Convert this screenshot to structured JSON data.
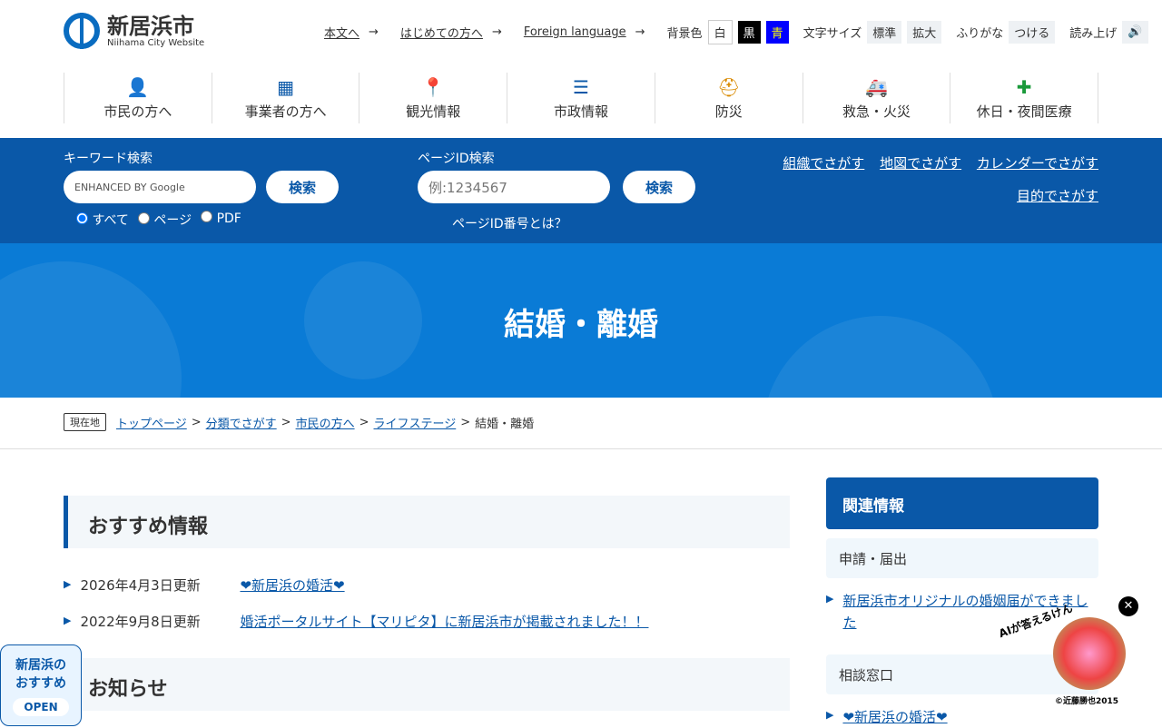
{
  "header": {
    "logo_title": "新居浜市",
    "logo_sub": "Niihama City Website",
    "util_links": [
      "本文へ",
      "はじめての方へ",
      "Foreign language"
    ],
    "bg_label": "背景色",
    "bg_options": [
      "白",
      "黒",
      "青"
    ],
    "font_label": "文字サイズ",
    "font_options": [
      "標準",
      "拡大"
    ],
    "furigana_label": "ふりがな",
    "furigana_btn": "つける",
    "read_label": "読み上げ"
  },
  "nav": [
    {
      "label": "市民の方へ",
      "icon": "person-icon",
      "glyph": "👤"
    },
    {
      "label": "事業者の方へ",
      "icon": "building-icon",
      "glyph": "▦"
    },
    {
      "label": "観光情報",
      "icon": "map-pin-icon",
      "glyph": "📍"
    },
    {
      "label": "市政情報",
      "icon": "list-icon",
      "glyph": "☰"
    },
    {
      "label": "防災",
      "icon": "helmet-icon",
      "glyph": "⛑"
    },
    {
      "label": "救急・火災",
      "icon": "ambulance-icon",
      "glyph": "🚑"
    },
    {
      "label": "休日・夜間医療",
      "icon": "first-aid-icon",
      "glyph": "✚"
    }
  ],
  "search": {
    "keyword_label": "キーワード検索",
    "google_placeholder": "ENHANCED BY Google",
    "search_btn": "検索",
    "radios": [
      "すべて",
      "ページ",
      "PDF"
    ],
    "pageid_label": "ページID検索",
    "pageid_placeholder": "例:1234567",
    "pageid_help": "ページID番号とは？",
    "links": [
      "組織でさがす",
      "地図でさがす",
      "カレンダーでさがす",
      "目的でさがす"
    ]
  },
  "hero_title": "結婚・離婚",
  "breadcrumb": {
    "here": "現在地",
    "items": [
      "トップページ",
      "分類でさがす",
      "市民の方へ",
      "ライフステージ"
    ],
    "current": "結婚・離婚"
  },
  "main": {
    "recommend_title": "おすすめ情報",
    "news": [
      {
        "date": "2026年4月3日更新",
        "title": "❤新居浜の婚活❤"
      },
      {
        "date": "2022年9月8日更新",
        "title": "婚活ポータルサイト【マリピタ】に新居浜市が掲載されました！！"
      }
    ],
    "notice_title": "お知らせ"
  },
  "side": {
    "title": "関連情報",
    "sub1": "申請・届出",
    "link1": "新居浜市オリジナルの婚姻届ができました",
    "sub2": "相談窓口",
    "link2": "❤新居浜の婚活❤"
  },
  "reco": {
    "line1": "新居浜の",
    "line2": "おすすめ",
    "open": "OPEN"
  },
  "ai": {
    "label": "AIが答えるけん",
    "copyright": "©近藤勝也2015"
  }
}
